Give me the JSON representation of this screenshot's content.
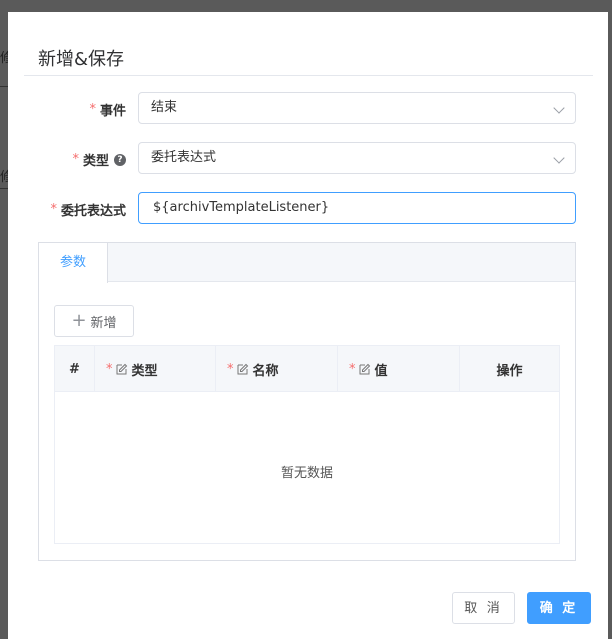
{
  "background": {
    "edge_text_1": "修",
    "edge_text_2": "修"
  },
  "dialog": {
    "title": "新增&保存"
  },
  "form": {
    "required_mark": "*",
    "event": {
      "label": "事件",
      "value": "结束"
    },
    "type": {
      "label": "类型",
      "value": "委托表达式",
      "help_icon": "?"
    },
    "delegate_expression": {
      "label": "委托表达式",
      "value": "${archivTemplateListener}"
    }
  },
  "tabs": [
    {
      "label": "参数",
      "active": true
    }
  ],
  "params": {
    "add_button_label": "新增",
    "columns": [
      "#",
      "类型",
      "名称",
      "值",
      "操作"
    ],
    "rows": [],
    "empty_text": "暂无数据"
  },
  "footer": {
    "cancel_label": "取 消",
    "ok_label": "确 定"
  },
  "colors": {
    "primary": "#409eff",
    "required": "#f56c6c",
    "border": "#dcdfe6",
    "header_bg": "#f5f7fa"
  }
}
